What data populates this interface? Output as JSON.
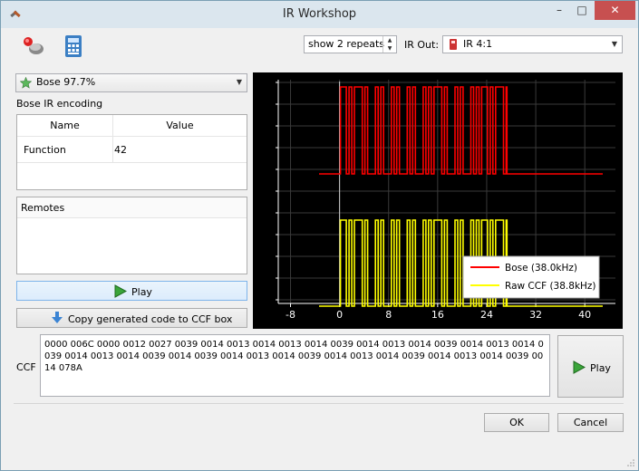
{
  "window": {
    "title": "IR Workshop"
  },
  "titlebar": {
    "minimize": "–",
    "maximize": "□",
    "close": "✕"
  },
  "toolbar": {
    "repeats_value": "show 2 repeats",
    "ir_out_label": "IR Out:",
    "ir_out_value": "IR 4:1"
  },
  "left": {
    "protocol_value": "Bose 97.7%",
    "encoding_label": "Bose IR encoding",
    "table": {
      "headers": [
        "Name",
        "Value"
      ],
      "rows": [
        {
          "name": "Function",
          "value": "42"
        }
      ]
    },
    "remotes_header": "Remotes",
    "play_label": "Play",
    "copy_label": "Copy generated code to CCF box"
  },
  "chart_data": {
    "type": "line",
    "x_ticks": [
      "-8",
      "0",
      "8",
      "16",
      "24",
      "32",
      "40"
    ],
    "xlim": [
      -10,
      45
    ],
    "grid": true,
    "legend_position": "bottom-right",
    "series": [
      {
        "name": "Bose (38.0kHz)",
        "color": "#ff0000"
      },
      {
        "name": "Raw CCF (38.8kHz)",
        "color": "#ffff00"
      }
    ]
  },
  "ccf": {
    "label": "CCF",
    "code": "0000 006C 0000 0012 0027 0039 0014 0013 0014 0013 0014 0039 0014 0013 0014 0039 0014 0013 0014 0039 0014 0013 0014 0039 0014 0039 0014 0013 0014 0039 0014 0013 0014 0039 0014 0013 0014 0039 0014 078A",
    "play_label": "Play"
  },
  "dialog": {
    "ok_label": "OK",
    "cancel_label": "Cancel"
  },
  "colors": {
    "plot_bg": "#000000",
    "bose": "#ff0000",
    "raw": "#ffff00",
    "grid": "#3a3a3a"
  }
}
